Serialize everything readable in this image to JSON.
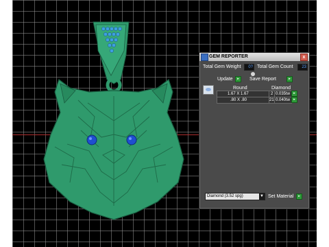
{
  "panel": {
    "title": "GEM REPORTER",
    "close_glyph": "x",
    "total_gem_weight_label": "Total Gem Weight",
    "total_gem_weight_value": "0?",
    "total_gem_count_label": "Total Gem Count",
    "total_gem_count_value": "23",
    "update_label": "Update",
    "save_report_label": "Save Report",
    "go_glyph": "▸",
    "table": {
      "columns": [
        "Round",
        "Diamond"
      ],
      "rows": [
        {
          "size": "1.67 X 1.67",
          "count": "2",
          "weight": "0.035tw"
        },
        {
          "size": ".80 X .80",
          "count": "21",
          "weight": "0.040tw"
        }
      ]
    },
    "material_value": "Diamond  (3.52 spg)",
    "dropdown_glyph": "▼",
    "set_material_label": "Set Material"
  },
  "icons": {
    "app": "gem-reporter-icon",
    "close": "close-icon",
    "expander": "expander-icon",
    "gem_thumbnail": "round-gem-icon"
  },
  "colors": {
    "model_green": "#2f9a6c",
    "gem_blue": "#1f4fd0",
    "panel_bg": "#4a4a4a",
    "value_text": "#5aa0ff"
  }
}
